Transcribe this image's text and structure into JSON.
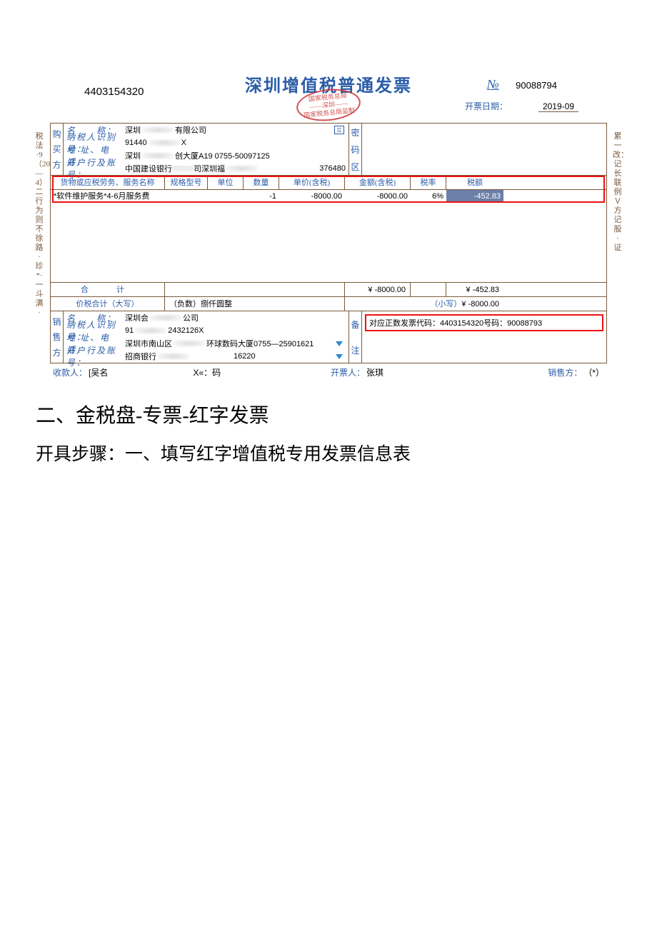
{
  "invoice": {
    "title": "深圳增值税普通发票",
    "stamp_top": "国家税务总局",
    "stamp_mid": "——深圳——",
    "stamp_bottom": "国家税务总局监制",
    "code_left": "4403154320",
    "no_label": "№",
    "no_value": "90088794",
    "date_label": "开票日期：",
    "date_value": "2019-09",
    "left_margin": "税法·9（20—4）二行为则不徐路·珍*·一斗满·",
    "right_margin": "累一改：记长联例Ｖ方记股·证",
    "buyer": {
      "section": "购买方",
      "name_k": "名　　称：",
      "name_v_prefix": "深圳",
      "name_v_suffix": "有限公司",
      "tax_k": "纳税人识别号：",
      "tax_v_prefix": "91440",
      "tax_v_suffix": "X",
      "addr_k": "地 址、电 话：",
      "addr_v_prefix": "深圳",
      "addr_v_suffix": "创大厦A19 0755-50097125",
      "bank_k": "开户行及账号：",
      "bank_v_prefix": "中国建设银行",
      "bank_v_mid": "司深圳福",
      "bank_v_suffix": "376480",
      "right_label": "密码区"
    },
    "columns": {
      "c1": "货物或应税劳务、服务名称",
      "c2": "规格型号",
      "c3": "单位",
      "c4": "数量",
      "c5": "单价(含税)",
      "c6": "金额(含税)",
      "c7": "税率",
      "c8": "税额"
    },
    "line": {
      "name": "*软件维护服务*4-6月服务费",
      "spec": "",
      "unit": "",
      "qty": "-1",
      "price": "-8000.00",
      "amount": "-8000.00",
      "rate": "6%",
      "tax": "-452.83"
    },
    "totals": {
      "row1_label": "合　计",
      "amount": "¥  -8000.00",
      "tax": "¥  -452.83",
      "row2_label": "价税合计（大写）",
      "cn": "（负数）捌仟圆整",
      "sm_label": "（小写）",
      "sm_value": "¥ -8000.00"
    },
    "seller": {
      "section": "销售方",
      "name_k": "名　　称：",
      "name_v_prefix": "深圳会",
      "name_v_suffix": "公司",
      "tax_k": "纳税人识别号：",
      "tax_v_prefix": "91",
      "tax_v_mid": "2432126X",
      "addr_k": "地 址、电 话：",
      "addr_v_prefix": "深圳市南山区",
      "addr_v_suffix": "环球数码大厦0755—25901621",
      "bank_k": "开户行及账号：",
      "bank_v_prefix": "招商银行",
      "bank_v_suffix": "16220",
      "remark_label": "备注",
      "remark_text": "对应正数发票代码：4403154320号码：90088793"
    },
    "footer": {
      "payee_k": "收款人：",
      "payee_v": "[吴名",
      "checker_k": "X«：码",
      "drawer_k": "开票人：",
      "drawer_v": "张琪",
      "seller_seal_k": "销售方：",
      "seller_seal_v": "（*）"
    }
  },
  "doc": {
    "h2": "二、金税盘-专票-红字发票",
    "step": "开具步骤：一、填写红字增值税专用发票信息表"
  }
}
